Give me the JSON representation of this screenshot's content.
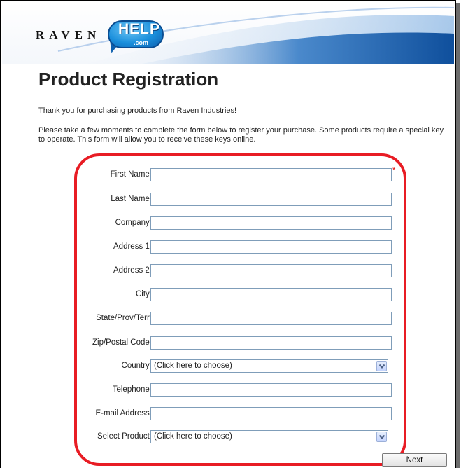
{
  "header": {
    "logo_raven": "RAVEN",
    "logo_help": "HELP",
    "logo_com": ".com"
  },
  "page": {
    "title": "Product Registration",
    "intro": "Thank you for purchasing products from Raven Industries!",
    "instructions": "Please take a few moments to complete the form below to register your purchase. Some products require a special key to operate. This form will allow you to receive these keys online."
  },
  "form": {
    "first_name": {
      "label": "First Name:",
      "value": "",
      "required_mark": "*"
    },
    "last_name": {
      "label": "Last Name:",
      "value": ""
    },
    "company": {
      "label": "Company:",
      "value": ""
    },
    "address1": {
      "label": "Address 1:",
      "value": ""
    },
    "address2": {
      "label": "Address 2:",
      "value": ""
    },
    "city": {
      "label": "City:",
      "value": ""
    },
    "state": {
      "label": "State/Prov/Terr:",
      "value": ""
    },
    "zip": {
      "label": "Zip/Postal Code:",
      "value": ""
    },
    "country": {
      "label": "Country:",
      "selected": "(Click here to choose)"
    },
    "telephone": {
      "label": "Telephone:",
      "value": ""
    },
    "email": {
      "label": "E-mail Address:",
      "value": ""
    },
    "product": {
      "label": "Select Product:",
      "selected": "(Click here to choose)"
    }
  },
  "actions": {
    "next_label": "Next"
  },
  "colors": {
    "highlight": "#e81c24",
    "field_border": "#7f9db9",
    "logo_blue": "#1a8fdc"
  }
}
